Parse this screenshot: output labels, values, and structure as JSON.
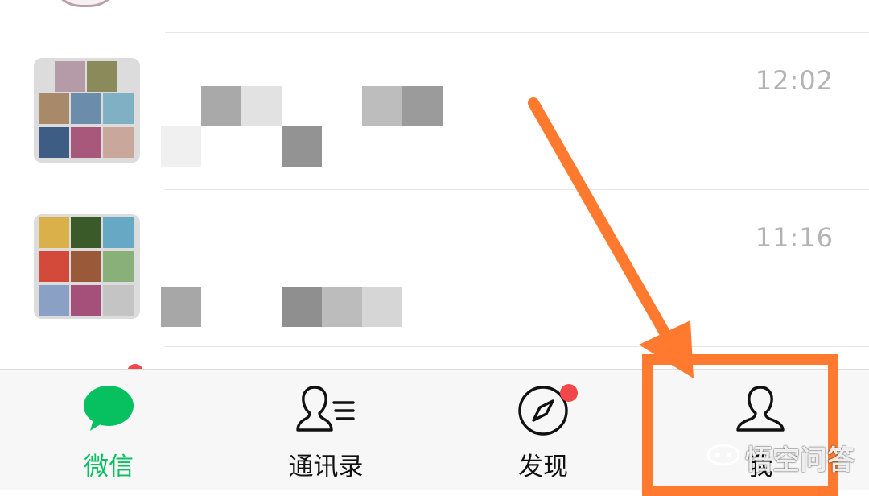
{
  "chat_list": {
    "rows": [
      {
        "time": "12:02"
      },
      {
        "time": "11:16"
      }
    ]
  },
  "tabbar": {
    "tabs": [
      {
        "label": "微信",
        "icon": "chat-bubble-icon",
        "active": true
      },
      {
        "label": "通讯录",
        "icon": "contacts-icon",
        "active": false
      },
      {
        "label": "发现",
        "icon": "compass-icon",
        "active": false,
        "badge": "red-dot"
      },
      {
        "label": "我",
        "icon": "person-icon",
        "active": false
      }
    ]
  },
  "watermark": {
    "text": "悟空问答"
  },
  "colors": {
    "accent_green": "#07c160",
    "badge_red": "#f4474b",
    "annotation_orange": "#ff7a2e",
    "time_gray": "#b3b3b3"
  }
}
